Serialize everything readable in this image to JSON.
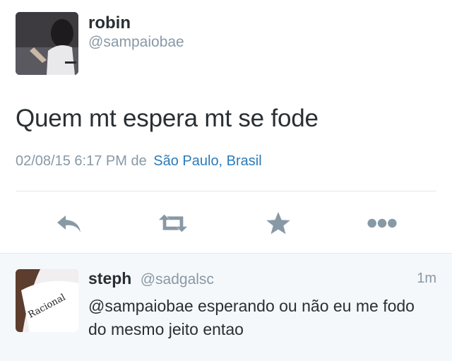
{
  "tweet": {
    "author_name": "robin",
    "author_handle": "@sampaiobae",
    "text": "Quem mt espera mt se fode",
    "timestamp": "02/08/15 6:17 PM",
    "location_prefix": "de",
    "location": "São Paulo, Brasil"
  },
  "actions": [
    {
      "icon": "reply-icon"
    },
    {
      "icon": "retweet-icon"
    },
    {
      "icon": "star-icon"
    },
    {
      "icon": "more-icon"
    }
  ],
  "reply": {
    "author_name": "steph",
    "author_handle": "@sadgalsc",
    "time": "1m",
    "text": "@sampaiobae esperando ou não eu me fodo do mesmo jeito entao"
  },
  "colors": {
    "text": "#292f33",
    "secondary": "#8899a6",
    "link": "#2b7bb9",
    "icon": "#8899a6",
    "reply_background": "#f5f8fa"
  }
}
